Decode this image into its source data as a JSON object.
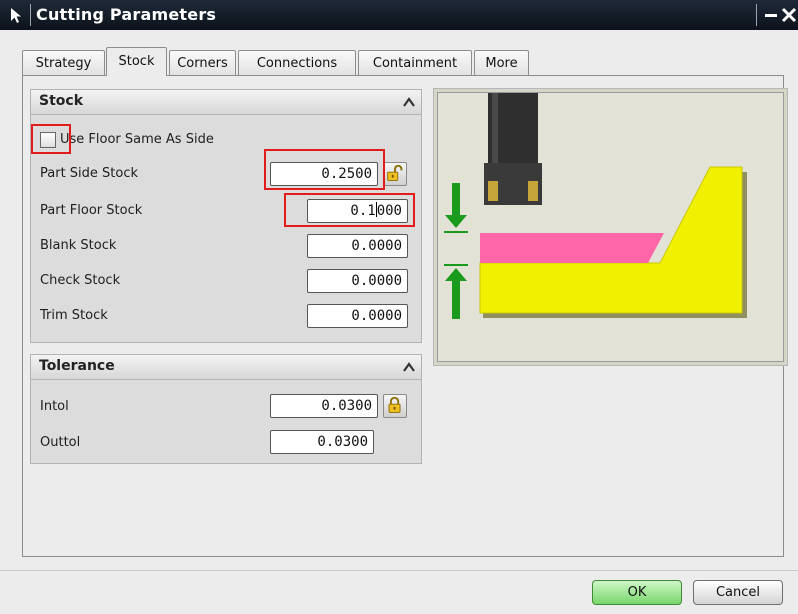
{
  "window": {
    "title": "Cutting Parameters",
    "minimize_glyph": "−",
    "close_glyph": "✕"
  },
  "tabs": [
    {
      "label": "Strategy",
      "active": false
    },
    {
      "label": "Stock",
      "active": true
    },
    {
      "label": "Corners",
      "active": false
    },
    {
      "label": "Connections",
      "active": false
    },
    {
      "label": "Containment",
      "active": false
    },
    {
      "label": "More",
      "active": false
    }
  ],
  "stock_group": {
    "title": "Stock",
    "use_floor_same_as_side": {
      "label": "Use Floor Same As Side",
      "checked": false
    },
    "part_side_stock": {
      "label": "Part Side Stock",
      "value": "0.2500"
    },
    "part_floor_stock": {
      "label": "Part Floor Stock",
      "value_before_caret": "0.1",
      "value_after_caret": "000"
    },
    "blank_stock": {
      "label": "Blank Stock",
      "value": "0.0000"
    },
    "check_stock": {
      "label": "Check Stock",
      "value": "0.0000"
    },
    "trim_stock": {
      "label": "Trim Stock",
      "value": "0.0000"
    }
  },
  "tolerance_group": {
    "title": "Tolerance",
    "intol": {
      "label": "Intol",
      "value": "0.0300"
    },
    "outtol": {
      "label": "Outtol",
      "value": "0.0300"
    }
  },
  "buttons": {
    "ok": "OK",
    "cancel": "Cancel"
  },
  "icons": {
    "title_icon": "cursor-arrow-icon",
    "lock_open": "unlocked-padlock-icon",
    "lock_closed": "locked-padlock-icon",
    "collapse": "chevron-up-icon"
  },
  "colors": {
    "highlight": "#e21b1b",
    "part_yellow": "#f0f000",
    "floor_stock_pink": "#ff66a8",
    "arrow_green": "#1a9a1a",
    "ok_green": "#77d66a"
  }
}
